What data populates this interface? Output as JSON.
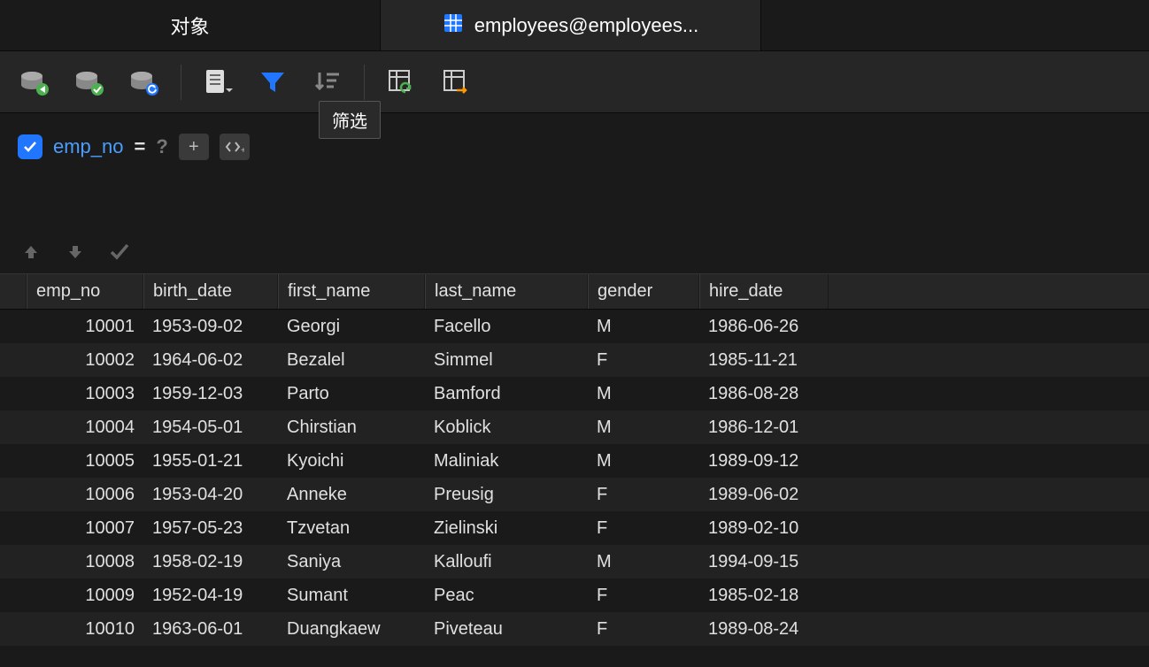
{
  "tabs": [
    {
      "label": "对象",
      "active": false,
      "has_icon": false
    },
    {
      "label": "employees@employees...",
      "active": true,
      "has_icon": true
    }
  ],
  "tooltip": "筛选",
  "filter": {
    "column": "emp_no",
    "operator": "=",
    "value_placeholder": "?",
    "plus": "+"
  },
  "columns": [
    "emp_no",
    "birth_date",
    "first_name",
    "last_name",
    "gender",
    "hire_date"
  ],
  "rows": [
    {
      "emp_no": "10001",
      "birth_date": "1953-09-02",
      "first_name": "Georgi",
      "last_name": "Facello",
      "gender": "M",
      "hire_date": "1986-06-26"
    },
    {
      "emp_no": "10002",
      "birth_date": "1964-06-02",
      "first_name": "Bezalel",
      "last_name": "Simmel",
      "gender": "F",
      "hire_date": "1985-11-21"
    },
    {
      "emp_no": "10003",
      "birth_date": "1959-12-03",
      "first_name": "Parto",
      "last_name": "Bamford",
      "gender": "M",
      "hire_date": "1986-08-28"
    },
    {
      "emp_no": "10004",
      "birth_date": "1954-05-01",
      "first_name": "Chirstian",
      "last_name": "Koblick",
      "gender": "M",
      "hire_date": "1986-12-01"
    },
    {
      "emp_no": "10005",
      "birth_date": "1955-01-21",
      "first_name": "Kyoichi",
      "last_name": "Maliniak",
      "gender": "M",
      "hire_date": "1989-09-12"
    },
    {
      "emp_no": "10006",
      "birth_date": "1953-04-20",
      "first_name": "Anneke",
      "last_name": "Preusig",
      "gender": "F",
      "hire_date": "1989-06-02"
    },
    {
      "emp_no": "10007",
      "birth_date": "1957-05-23",
      "first_name": "Tzvetan",
      "last_name": "Zielinski",
      "gender": "F",
      "hire_date": "1989-02-10"
    },
    {
      "emp_no": "10008",
      "birth_date": "1958-02-19",
      "first_name": "Saniya",
      "last_name": "Kalloufi",
      "gender": "M",
      "hire_date": "1994-09-15"
    },
    {
      "emp_no": "10009",
      "birth_date": "1952-04-19",
      "first_name": "Sumant",
      "last_name": "Peac",
      "gender": "F",
      "hire_date": "1985-02-18"
    },
    {
      "emp_no": "10010",
      "birth_date": "1963-06-01",
      "first_name": "Duangkaew",
      "last_name": "Piveteau",
      "gender": "F",
      "hire_date": "1989-08-24"
    }
  ]
}
